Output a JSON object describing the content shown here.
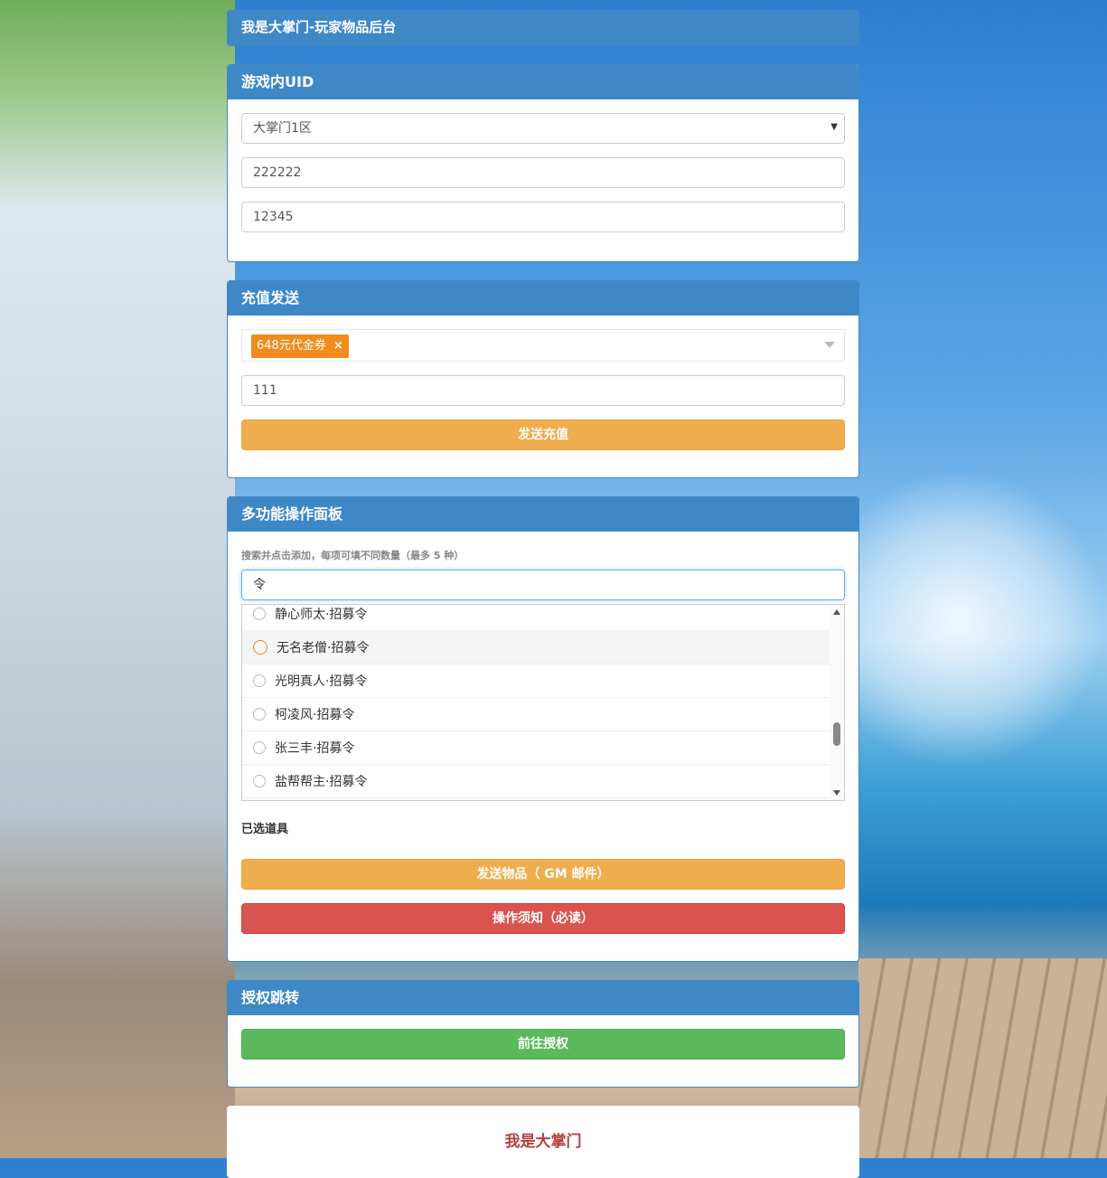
{
  "header": {
    "title": "我是大掌门-玩家物品后台"
  },
  "uid_panel": {
    "title": "游戏内UID",
    "server_selected": "大掌门1区",
    "field_1_value": "222222",
    "field_2_value": "12345"
  },
  "recharge_panel": {
    "title": "充值发送",
    "selected_tag": "648元代金券",
    "tag_remove": "×",
    "amount_value": "111",
    "send_button": "发送充值"
  },
  "multi_panel": {
    "title": "多功能操作面板",
    "hint": "搜索并点击添加，每项可填不同数量（最多 5 种）",
    "search_value": "令",
    "options": [
      {
        "label": "静心师太·招募令",
        "highlighted": false
      },
      {
        "label": "无名老僧·招募令",
        "highlighted": true
      },
      {
        "label": "光明真人·招募令",
        "highlighted": false
      },
      {
        "label": "柯凌风·招募令",
        "highlighted": false
      },
      {
        "label": "张三丰·招募令",
        "highlighted": false
      },
      {
        "label": "盐帮帮主·招募令",
        "highlighted": false
      }
    ],
    "selected_label": "已选道具",
    "send_items_button": "发送物品（ GM 邮件）",
    "notice_button": "操作须知（必读）"
  },
  "auth_panel": {
    "title": "授权跳转",
    "go_button": "前往授权"
  },
  "footer": {
    "text": "我是大掌门"
  },
  "colors": {
    "panel_blue": "#3f88c8",
    "orange": "#f0ad4e",
    "red": "#d9534f",
    "green": "#5cb85c",
    "tag_orange": "#f08c1e",
    "footer_text": "#b5403d"
  }
}
